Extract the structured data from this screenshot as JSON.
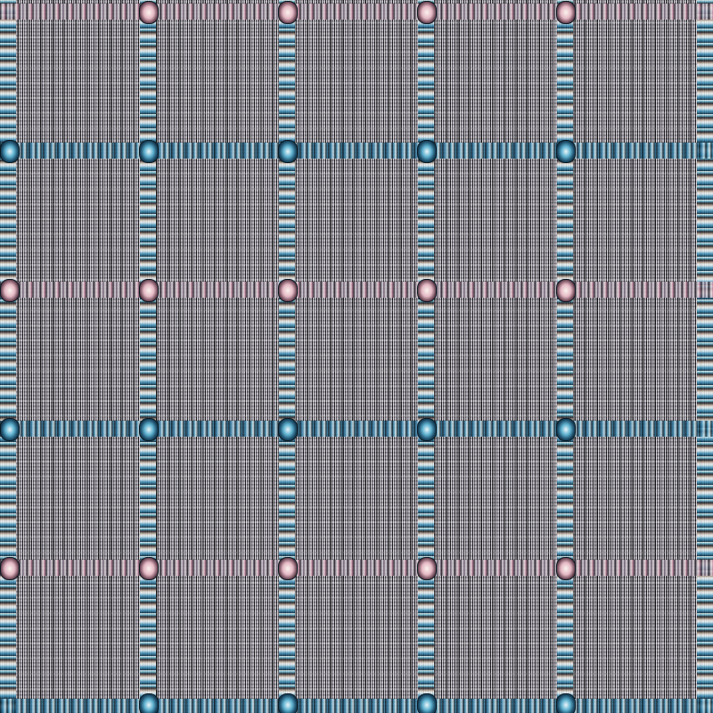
{
  "image": {
    "kind": "abstract glitch texture",
    "palette": {
      "base_gray": "#7e7b82",
      "dark": "#0a0a0e",
      "light": "#f0ecf0",
      "accent_blue": "#3a8fb8",
      "accent_cyan": "#5fb0c8",
      "accent_pink": "#c48aa0"
    },
    "tiles": {
      "columns": 5,
      "rows": 5
    }
  }
}
